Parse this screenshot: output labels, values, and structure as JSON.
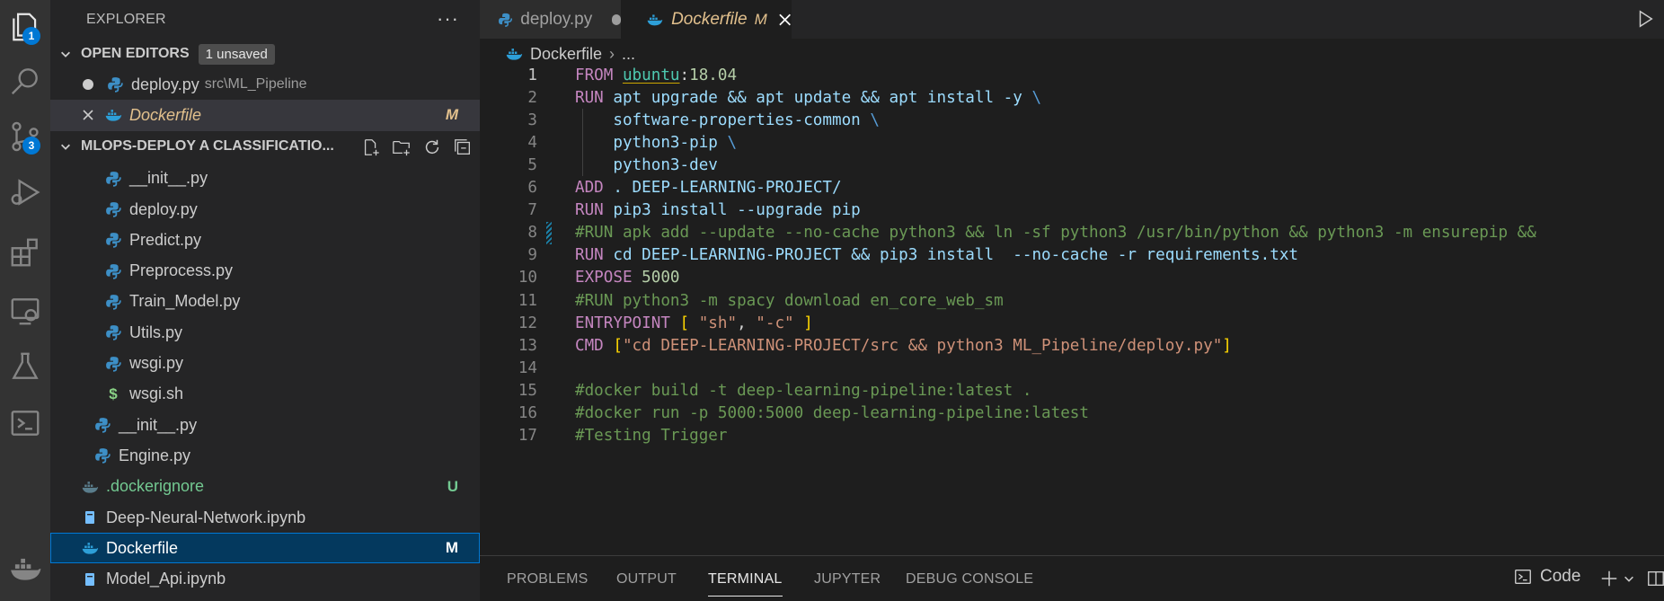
{
  "activity_bar": {
    "items": [
      {
        "name": "explorer-icon",
        "badge": "1"
      },
      {
        "name": "search-icon",
        "badge": ""
      },
      {
        "name": "source-control-icon",
        "badge": "3"
      },
      {
        "name": "run-debug-icon",
        "badge": ""
      },
      {
        "name": "extensions-icon",
        "badge": ""
      },
      {
        "name": "remote-explorer-icon",
        "badge": ""
      },
      {
        "name": "testing-icon",
        "badge": ""
      },
      {
        "name": "terminal-icon",
        "badge": ""
      },
      {
        "name": "docker-icon",
        "badge": ""
      }
    ]
  },
  "sidebar": {
    "title": "EXPLORER",
    "open_editors": {
      "label": "OPEN EDITORS",
      "badge": "1 unsaved",
      "items": [
        {
          "name": "deploy.py",
          "path": "src\\ML_Pipeline",
          "status": ""
        },
        {
          "name": "Dockerfile",
          "path": "",
          "status": "M"
        }
      ]
    },
    "workspace": {
      "label": "MLOPS-DEPLOY A CLASSIFICATIO...",
      "items": [
        {
          "name": "__init__.py",
          "status": ""
        },
        {
          "name": "deploy.py",
          "status": ""
        },
        {
          "name": "Predict.py",
          "status": ""
        },
        {
          "name": "Preprocess.py",
          "status": ""
        },
        {
          "name": "Train_Model.py",
          "status": ""
        },
        {
          "name": "Utils.py",
          "status": ""
        },
        {
          "name": "wsgi.py",
          "status": ""
        },
        {
          "name": "wsgi.sh",
          "status": ""
        },
        {
          "name": "__init__.py",
          "status": ""
        },
        {
          "name": "Engine.py",
          "status": ""
        },
        {
          "name": ".dockerignore",
          "status": "U"
        },
        {
          "name": "Deep-Neural-Network.ipynb",
          "status": ""
        },
        {
          "name": "Dockerfile",
          "status": "M"
        },
        {
          "name": "Model_Api.ipynb",
          "status": ""
        }
      ]
    }
  },
  "tabs": [
    {
      "label": "deploy.py",
      "state": "unsaved"
    },
    {
      "label": "Dockerfile",
      "state": "M"
    }
  ],
  "breadcrumb": {
    "file": "Dockerfile",
    "rest": "..."
  },
  "code": {
    "line_numbers": [
      "1",
      "2",
      "3",
      "4",
      "5",
      "6",
      "7",
      "8",
      "9",
      "10",
      "11",
      "12",
      "13",
      "14",
      "15",
      "16",
      "17"
    ],
    "lines": [
      "FROM ubuntu:18.04",
      "RUN apt upgrade && apt update && apt install -y \\",
      "    software-properties-common \\",
      "    python3-pip \\",
      "    python3-dev",
      "ADD . DEEP-LEARNING-PROJECT/",
      "RUN pip3 install --upgrade pip",
      "#RUN apk add --update --no-cache python3 && ln -sf python3 /usr/bin/python && python3 -m ensurepip &&",
      "RUN cd DEEP-LEARNING-PROJECT && pip3 install  --no-cache -r requirements.txt",
      "EXPOSE 5000",
      "#RUN python3 -m spacy download en_core_web_sm",
      "ENTRYPOINT [ \"sh\", \"-c\" ]",
      "CMD [\"cd DEEP-LEARNING-PROJECT/src && python3 ML_Pipeline/deploy.py\"]",
      "",
      "#docker build -t deep-learning-pipeline:latest .",
      "#docker run -p 5000:5000 deep-learning-pipeline:latest",
      "#Testing Trigger"
    ]
  },
  "panel": {
    "tabs": [
      "PROBLEMS",
      "OUTPUT",
      "TERMINAL",
      "JUPYTER",
      "DEBUG CONSOLE"
    ],
    "active_tab": "TERMINAL",
    "terminal_name": "Code"
  },
  "colors": {
    "accent": "#0078d4",
    "modified": "#e2c08d",
    "untracked": "#73c991",
    "python_icon": "#3d8fc6",
    "docker_icon": "#2d9fd8"
  }
}
